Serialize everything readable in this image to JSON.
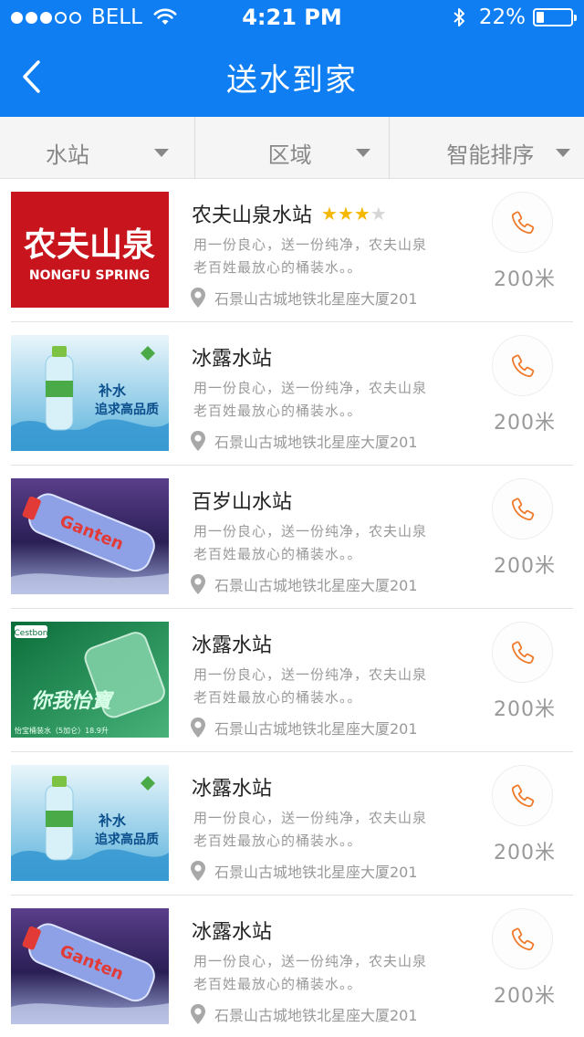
{
  "status_bar": {
    "carrier": "BELL",
    "time": "4:21 PM",
    "battery_percent": "22%",
    "battery_level": 0.22,
    "signal_dots_filled": 3,
    "signal_dots_total": 5
  },
  "nav": {
    "title": "送水到家",
    "back_icon": "chevron-left-icon"
  },
  "filters": [
    {
      "label": "水站"
    },
    {
      "label": "区域"
    },
    {
      "label": "智能排序"
    }
  ],
  "colors": {
    "brand": "#0f7ef2",
    "phone_accent": "#f07a2b",
    "star_filled": "#f5b800",
    "star_empty": "#d6d6d6"
  },
  "stations": [
    {
      "name": "农夫山泉水站",
      "rating": 3,
      "rating_max": 4,
      "desc_line1": "用一份良心，送一份纯净，农夫山泉",
      "desc_line2": "老百姓最放心的桶装水。。",
      "address": "石景山古城地铁北星座大厦201",
      "distance": "200米",
      "thumb": "nongfu",
      "thumb_text": [
        "农夫山泉",
        "NONGFU SPRING"
      ]
    },
    {
      "name": "冰露水站",
      "desc_line1": "用一份良心，送一份纯净，农夫山泉",
      "desc_line2": "老百姓最放心的桶装水。。",
      "address": "石景山古城地铁北星座大厦201",
      "distance": "200米",
      "thumb": "binglu",
      "thumb_text": [
        "补水",
        "追求高品质"
      ]
    },
    {
      "name": "百岁山水站",
      "desc_line1": "用一份良心，送一份纯净，农夫山泉",
      "desc_line2": "老百姓最放心的桶装水。。",
      "address": "石景山古城地铁北星座大厦201",
      "distance": "200米",
      "thumb": "ganten",
      "thumb_text": [
        "Ganten"
      ]
    },
    {
      "name": "冰露水站",
      "desc_line1": "用一份良心，送一份纯净，农夫山泉",
      "desc_line2": "老百姓最放心的桶装水。。",
      "address": "石景山古城地铁北星座大厦201",
      "distance": "200米",
      "thumb": "cestbon",
      "thumb_text": [
        "Cestbon",
        "你我怡寶",
        "怡宝桶装水（5加仑）18.9升"
      ]
    },
    {
      "name": "冰露水站",
      "desc_line1": "用一份良心，送一份纯净，农夫山泉",
      "desc_line2": "老百姓最放心的桶装水。。",
      "address": "石景山古城地铁北星座大厦201",
      "distance": "200米",
      "thumb": "binglu",
      "thumb_text": [
        "补水",
        "追求高品质"
      ]
    },
    {
      "name": "冰露水站",
      "desc_line1": "用一份良心，送一份纯净，农夫山泉",
      "desc_line2": "老百姓最放心的桶装水。。",
      "address": "石景山古城地铁北星座大厦201",
      "distance": "200米",
      "thumb": "ganten",
      "thumb_text": [
        "Ganten"
      ]
    }
  ]
}
